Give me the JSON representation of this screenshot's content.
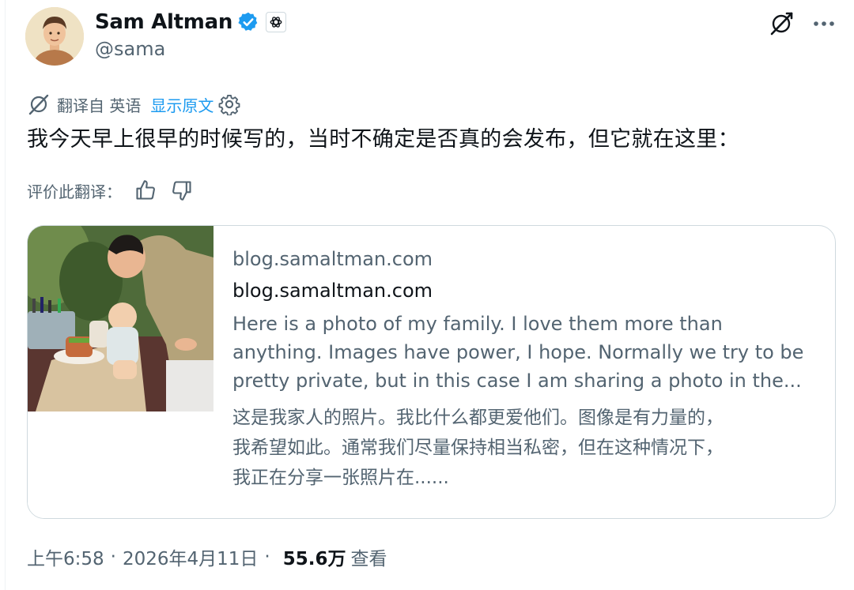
{
  "author": {
    "display_name": "Sam Altman",
    "handle": "@sama",
    "verified_icon": "verified-badge-icon",
    "affiliate_icon": "openai-logo-icon"
  },
  "header_icons": [
    "grok-icon",
    "more-icon"
  ],
  "translation": {
    "prefix": "翻译自 英语",
    "show_original": "显示原文"
  },
  "tweet": {
    "text": "我今天早上很早的时候写的，当时不确定是否真的会发布，但它就在这里："
  },
  "rating": {
    "label": "评价此翻译："
  },
  "card": {
    "domain": "blog.samaltman.com",
    "title": "blog.samaltman.com",
    "description_lines": [
      "Here is a photo of my family. I love them more than",
      "anything. Images have power, I hope. Normally we try to be",
      "pretty private, but in this case I am sharing a photo in the..."
    ],
    "translation_lines": [
      "这是我家人的照片。我比什么都更爱他们。图像是有力量的，",
      "我希望如此。通常我们尽量保持相当私密，但在这种情况下，",
      "我正在分享一张照片在......"
    ]
  },
  "meta": {
    "time": "上午6:58",
    "date": "2026年4月11日",
    "views_count": "55.6万",
    "views_label": "查看"
  },
  "colors": {
    "link": "#1d9bf0",
    "secondary_text": "#536471",
    "primary_text": "#0f1419",
    "border": "#cfd9de"
  }
}
